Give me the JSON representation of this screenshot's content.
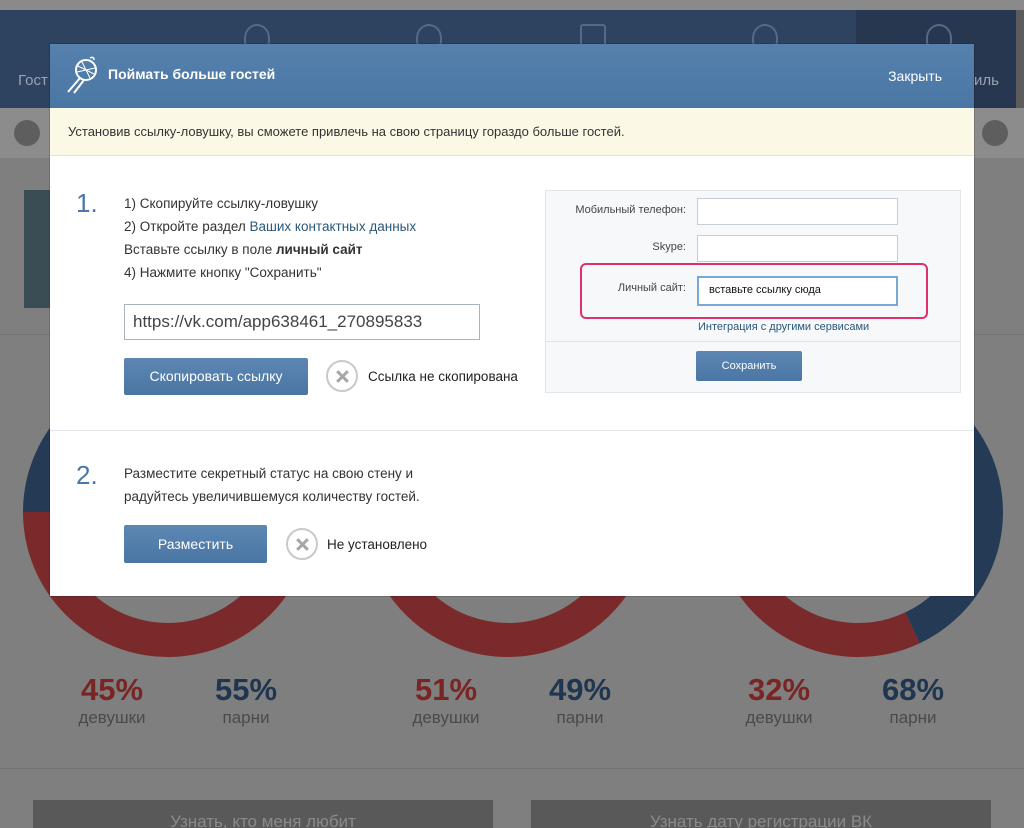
{
  "background": {
    "tabs": [
      {
        "label": "Гост"
      },
      {
        "label": "иль"
      }
    ],
    "stats": [
      {
        "girls_pct": "45%",
        "boys_pct": "55%",
        "girls_label": "девушки",
        "boys_label": "парни",
        "girls": 45,
        "boys": 55
      },
      {
        "girls_pct": "51%",
        "boys_pct": "49%",
        "girls_label": "девушки",
        "boys_label": "парни",
        "girls": 51,
        "boys": 49
      },
      {
        "girls_pct": "32%",
        "boys_pct": "68%",
        "girls_label": "девушки",
        "boys_label": "парни",
        "girls": 32,
        "boys": 68
      }
    ],
    "buttons": [
      {
        "label": "Узнать, кто меня любит"
      },
      {
        "label": "Узнать дату регистрации ВК"
      }
    ]
  },
  "modal": {
    "title": "Поймать больше гостей",
    "close_label": "Закрыть",
    "notice": "Установив ссылку-ловушку, вы сможете привлечь на свою страницу гораздо больше гостей.",
    "step1": {
      "number": "1.",
      "line1": "1) Скопируйте ссылку-ловушку",
      "line2_prefix": "2) Откройте раздел ",
      "line2_link": "Ваших контактных данных",
      "line3_prefix": "Вставьте ссылку в поле ",
      "line3_bold": "личный сайт",
      "line4": "4) Нажмите кнопку \"Сохранить\"",
      "url": "https://vk.com/app638461_270895833",
      "copy_button": "Скопировать ссылку",
      "copy_status": "Ссылка не скопирована",
      "illustration": {
        "mobile_label": "Мобильный телефон:",
        "skype_label": "Skype:",
        "site_label": "Личный сайт:",
        "site_value": "вставьте ссылку сюда",
        "integration_link": "Интеграция с другими сервисами",
        "save_button": "Сохранить",
        "highlight_color": "#e0306a"
      }
    },
    "step2": {
      "number": "2.",
      "line1": "Разместите секретный статус на свою стену и",
      "line2": "радуйтесь увеличившемуся количеству гостей.",
      "post_button": "Разместить",
      "post_status": "Не установлено"
    }
  }
}
